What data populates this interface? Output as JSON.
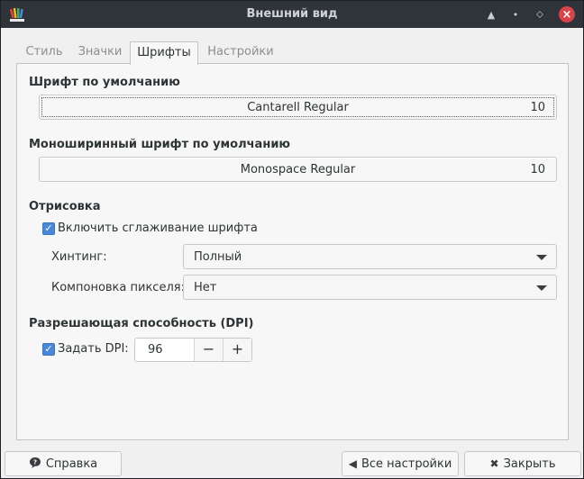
{
  "window": {
    "title": "Внешний вид",
    "controls": {
      "minimize": "▲",
      "maximize": "•",
      "restore": "⬦",
      "close": "×"
    }
  },
  "tabs": [
    {
      "label": "Стиль",
      "active": false
    },
    {
      "label": "Значки",
      "active": false
    },
    {
      "label": "Шрифты",
      "active": true
    },
    {
      "label": "Настройки",
      "active": false
    }
  ],
  "fonts": {
    "default_title": "Шрифт по умолчанию",
    "default_font": {
      "name": "Cantarell Regular",
      "size": "10"
    },
    "mono_title": "Моноширинный шрифт по умолчанию",
    "mono_font": {
      "name": "Monospace Regular",
      "size": "10"
    }
  },
  "rendering": {
    "title": "Отрисовка",
    "antialias_label": "Включить сглаживание шрифта",
    "antialias_checked": true,
    "hinting_label": "Хинтинг:",
    "hinting_value": "Полный",
    "subpixel_label": "Компоновка пикселя:",
    "subpixel_value": "Нет"
  },
  "dpi": {
    "title": "Разрешающая способность (DPI)",
    "set_label": "Задать DPI:",
    "set_checked": true,
    "value": "96",
    "decrement": "−",
    "increment": "+"
  },
  "footer": {
    "help_label": "Справка",
    "all_settings_label": "Все настройки",
    "close_label": "Закрыть"
  },
  "icons": {
    "help": "help-icon",
    "back": "arrow-left-icon",
    "close": "close-icon",
    "check": "checkmark-icon",
    "dropdown": "chevron-down-icon"
  },
  "colors": {
    "titlebar": "#2f333a",
    "accent": "#4a88d6",
    "close_button": "#d9434c"
  }
}
